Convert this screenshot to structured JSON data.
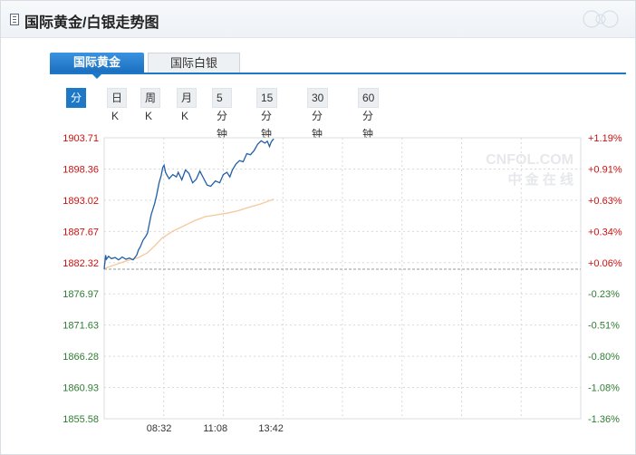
{
  "header": {
    "title": "国际黄金/白银走势图"
  },
  "tabs": [
    {
      "label": "国际黄金",
      "active": true
    },
    {
      "label": "国际白银",
      "active": false
    }
  ],
  "periods": [
    {
      "label": "分时",
      "active": true
    },
    {
      "label": "日K",
      "active": false
    },
    {
      "label": "周K",
      "active": false
    },
    {
      "label": "月K",
      "active": false
    },
    {
      "label": "5分钟",
      "active": false
    },
    {
      "label": "15分钟",
      "active": false
    },
    {
      "label": "30分钟",
      "active": false
    },
    {
      "label": "60分钟",
      "active": false
    }
  ],
  "watermark": {
    "brand": "CNFOL.COM",
    "cn": "中 金 在 线"
  },
  "colors": {
    "price_line": "#1f5fa8",
    "avg_line": "#f5c89a",
    "up": "#cc1111",
    "down": "#2e7d32",
    "accent": "#1e78c8"
  },
  "chart_data": {
    "type": "line",
    "title": "",
    "ylim": [
      1855.58,
      1903.71
    ],
    "reference_price": 1881.2,
    "y_ticks_left": [
      "1903.71",
      "1898.36",
      "1893.02",
      "1887.67",
      "1882.32",
      "1876.97",
      "1871.63",
      "1866.28",
      "1860.93",
      "1855.58"
    ],
    "y_ticks_right": [
      "+1.19%",
      "+0.91%",
      "+0.63%",
      "+0.34%",
      "+0.06%",
      "-0.23%",
      "-0.51%",
      "-0.80%",
      "-1.08%",
      "-1.36%"
    ],
    "x_tick_labels": [
      "08:32",
      "11:08",
      "13:42"
    ],
    "x_range_minutes": [
      360,
      1680
    ],
    "x_tick_minutes": [
      512,
      668,
      822
    ],
    "series": [
      {
        "key": "price",
        "x_minutes": [
          360,
          364,
          366,
          372,
          380,
          390,
          400,
          410,
          420,
          430,
          440,
          450,
          455,
          460,
          468,
          475,
          480,
          490,
          500,
          505,
          512,
          518,
          522,
          526,
          530,
          535,
          540,
          550,
          560,
          565,
          575,
          585,
          595,
          605,
          615,
          625,
          635,
          645,
          655,
          668,
          680,
          690,
          700,
          708,
          715,
          725,
          735,
          745,
          755,
          765,
          775,
          785,
          795,
          805,
          812,
          818,
          822,
          826,
          830
        ],
        "values": [
          1881.2,
          1883.6,
          1882.9,
          1883.4,
          1883.0,
          1883.2,
          1882.8,
          1883.3,
          1882.9,
          1883.1,
          1882.8,
          1883.6,
          1884.5,
          1885.0,
          1886.2,
          1886.8,
          1887.4,
          1890.5,
          1892.5,
          1893.8,
          1896.0,
          1897.3,
          1898.6,
          1899.0,
          1897.8,
          1897.2,
          1896.7,
          1897.4,
          1897.0,
          1897.8,
          1896.5,
          1898.2,
          1897.6,
          1896.0,
          1896.6,
          1898.0,
          1896.8,
          1895.6,
          1895.4,
          1896.3,
          1896.0,
          1897.4,
          1897.8,
          1897.0,
          1898.2,
          1899.2,
          1899.8,
          1899.6,
          1901.0,
          1900.8,
          1901.5,
          1902.6,
          1903.2,
          1902.8,
          1903.1,
          1902.2,
          1902.9,
          1903.3,
          1903.5
        ]
      },
      {
        "key": "average",
        "x_minutes": [
          360,
          420,
          455,
          480,
          500,
          520,
          550,
          580,
          610,
          640,
          670,
          700,
          730,
          760,
          790,
          830
        ],
        "values": [
          1881.3,
          1882.6,
          1883.2,
          1884.0,
          1885.2,
          1886.5,
          1887.7,
          1888.6,
          1889.5,
          1890.2,
          1890.5,
          1890.8,
          1891.2,
          1891.8,
          1892.3,
          1893.2
        ]
      }
    ]
  }
}
